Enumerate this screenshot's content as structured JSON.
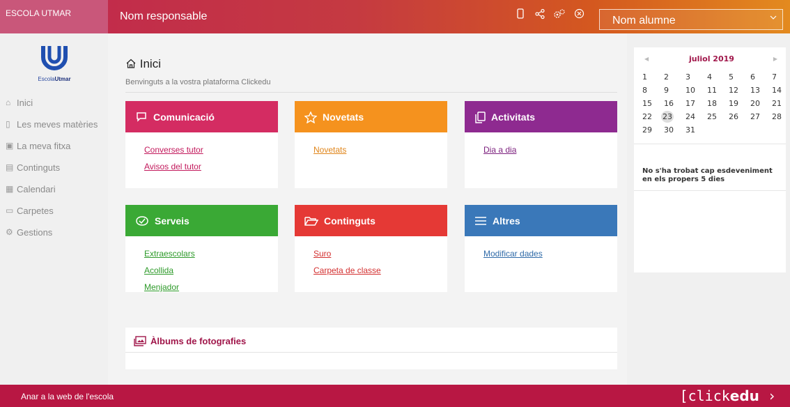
{
  "header": {
    "school_name": "ESCOLA UTMAR",
    "responsible": "Nom responsable",
    "icons": [
      "mobile-icon",
      "share-icon",
      "settings-icon",
      "close-circle-icon"
    ],
    "student_select": {
      "value": "Nom alumne"
    }
  },
  "sidebar": {
    "logo_text": {
      "a": "Escola",
      "b": "Utmar"
    },
    "items": [
      {
        "icon": "home-icon",
        "label": "Inici"
      },
      {
        "icon": "bookmark-icon",
        "label": "Les meves matèries"
      },
      {
        "icon": "profile-card-icon",
        "label": "La meva fitxa"
      },
      {
        "icon": "document-icon",
        "label": "Continguts"
      },
      {
        "icon": "calendar-icon",
        "label": "Calendari"
      },
      {
        "icon": "folder-icon",
        "label": "Carpetes"
      },
      {
        "icon": "gears-icon",
        "label": "Gestions"
      }
    ]
  },
  "main": {
    "title": "Inici",
    "subtitle": "Benvinguts a la vostra plataforma Clickedu",
    "cards": [
      {
        "title": "Comunicació",
        "color": "#d42c62",
        "icon": "chat-icon",
        "links": [
          "Converses tutor",
          "Avisos del tutor"
        ]
      },
      {
        "title": "Novetats",
        "color": "#f5921e",
        "icon": "star-icon",
        "links": [
          "Novetats"
        ]
      },
      {
        "title": "Activitats",
        "color": "#8e2a90",
        "icon": "copy-icon",
        "links": [
          "Dia a dia"
        ]
      },
      {
        "title": "Serveis",
        "color": "#3aa935",
        "icon": "services-icon",
        "links": [
          "Extraescolars",
          "Acollida",
          "Menjador"
        ]
      },
      {
        "title": "Continguts",
        "color": "#e53935",
        "icon": "folder-open-icon",
        "links": [
          "Suro",
          "Carpeta de classe"
        ]
      },
      {
        "title": "Altres",
        "color": "#3a78b9",
        "icon": "list-icon",
        "links": [
          "Modificar dades"
        ]
      }
    ],
    "albums_title": "Àlbums de fotografies"
  },
  "calendar": {
    "month": "juliol 2019",
    "days": [
      [
        "1",
        "2",
        "3",
        "4",
        "5",
        "6",
        "7"
      ],
      [
        "8",
        "9",
        "10",
        "11",
        "12",
        "13",
        "14"
      ],
      [
        "15",
        "16",
        "17",
        "18",
        "19",
        "20",
        "21"
      ],
      [
        "22",
        "23",
        "24",
        "25",
        "26",
        "27",
        "28"
      ],
      [
        "29",
        "30",
        "31",
        "",
        "",
        "",
        ""
      ]
    ],
    "today": "23",
    "empty_message": "No s'ha trobat cap esdeveniment en els propers 5 dies"
  },
  "footer": {
    "web_link": "Anar a la web de l'escola",
    "brand_a": "[click",
    "brand_b": "edu"
  },
  "colors": {
    "accent": "#b81743",
    "month": "#a0164a"
  }
}
